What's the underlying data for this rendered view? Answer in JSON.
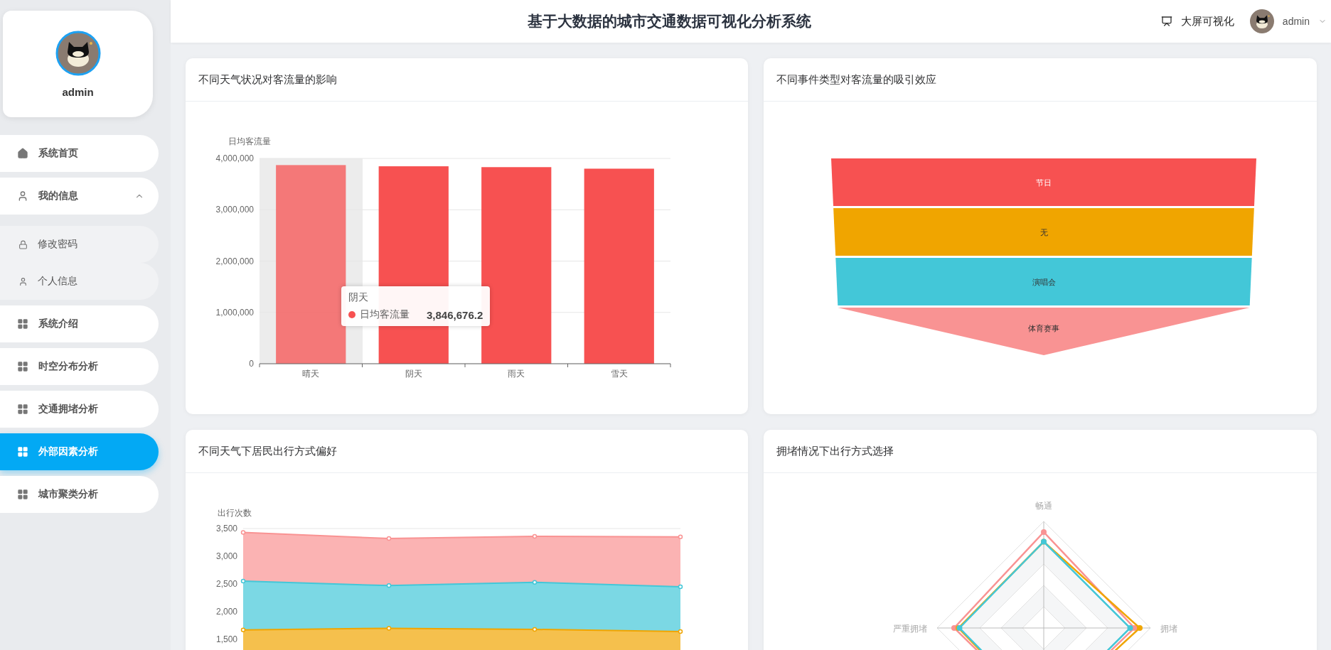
{
  "header": {
    "title": "基于大数据的城市交通数据可视化分析系统",
    "bigscreen_link": "大屏可视化",
    "user": "admin"
  },
  "sidebar": {
    "profile_name": "admin",
    "items": [
      {
        "label": "系统首页",
        "selected": false
      },
      {
        "label": "我的信息",
        "selected": false,
        "expanded": true,
        "children": [
          {
            "label": "修改密码",
            "selected": false
          },
          {
            "label": "个人信息",
            "selected": false
          }
        ]
      },
      {
        "label": "系统介绍",
        "selected": false
      },
      {
        "label": "时空分布分析",
        "selected": false
      },
      {
        "label": "交通拥堵分析",
        "selected": false
      },
      {
        "label": "外部因素分析",
        "selected": true
      },
      {
        "label": "城市聚类分析",
        "selected": false
      }
    ]
  },
  "panels": [
    {
      "title": "不同天气状况对客流量的影响",
      "chart_data": {
        "type": "bar",
        "ylabel": "日均客流量",
        "categories": [
          "晴天",
          "阴天",
          "雨天",
          "雪天"
        ],
        "series": [
          {
            "name": "日均客流量",
            "color": "#f75151",
            "values": [
              3870000,
              3846676,
              3830000,
              3800000
            ]
          }
        ],
        "grid": true,
        "ylim": [
          0,
          4000000
        ],
        "yticks": [
          {
            "value": 0,
            "label": "0"
          },
          {
            "value": 1000000,
            "label": "1,000,000"
          },
          {
            "value": 2000000,
            "label": "2,000,000"
          },
          {
            "value": 3000000,
            "label": "3,000,000"
          },
          {
            "value": 4000000,
            "label": "4,000,000"
          }
        ]
      },
      "bar_highlight": [
        true,
        false,
        false,
        false
      ],
      "tooltip": {
        "title": "阴天",
        "value": "3,846,676.2",
        "color": "#f75151"
      }
    },
    {
      "title": "不同事件类型对客流量的吸引效应",
      "funnel": [
        {
          "label": "节日",
          "color": "#f75151"
        },
        {
          "label": "无",
          "color": "#f0a500"
        },
        {
          "label": "演唱会",
          "color": "#43c7d8"
        },
        {
          "label": "体育赛事",
          "color": "#f99393"
        }
      ]
    },
    {
      "title": "不同天气下居民出行方式偏好",
      "area_chart": {
        "ylabel": "出行次数",
        "yticks": [
          "3,500",
          "3,000",
          "2,500",
          "2,000",
          "1,500"
        ],
        "series": [
          {
            "color": "#f99393"
          },
          {
            "color": "#43c7d8"
          },
          {
            "color": "#f0a500"
          }
        ]
      }
    },
    {
      "title": "拥堵情况下出行方式选择",
      "radar": {
        "axes": [
          "畅通",
          "拥堵",
          "严重拥堵"
        ],
        "series": [
          {
            "color": "#f99393"
          },
          {
            "color": "#f0a500"
          },
          {
            "color": "#43c7d8"
          }
        ]
      }
    }
  ]
}
